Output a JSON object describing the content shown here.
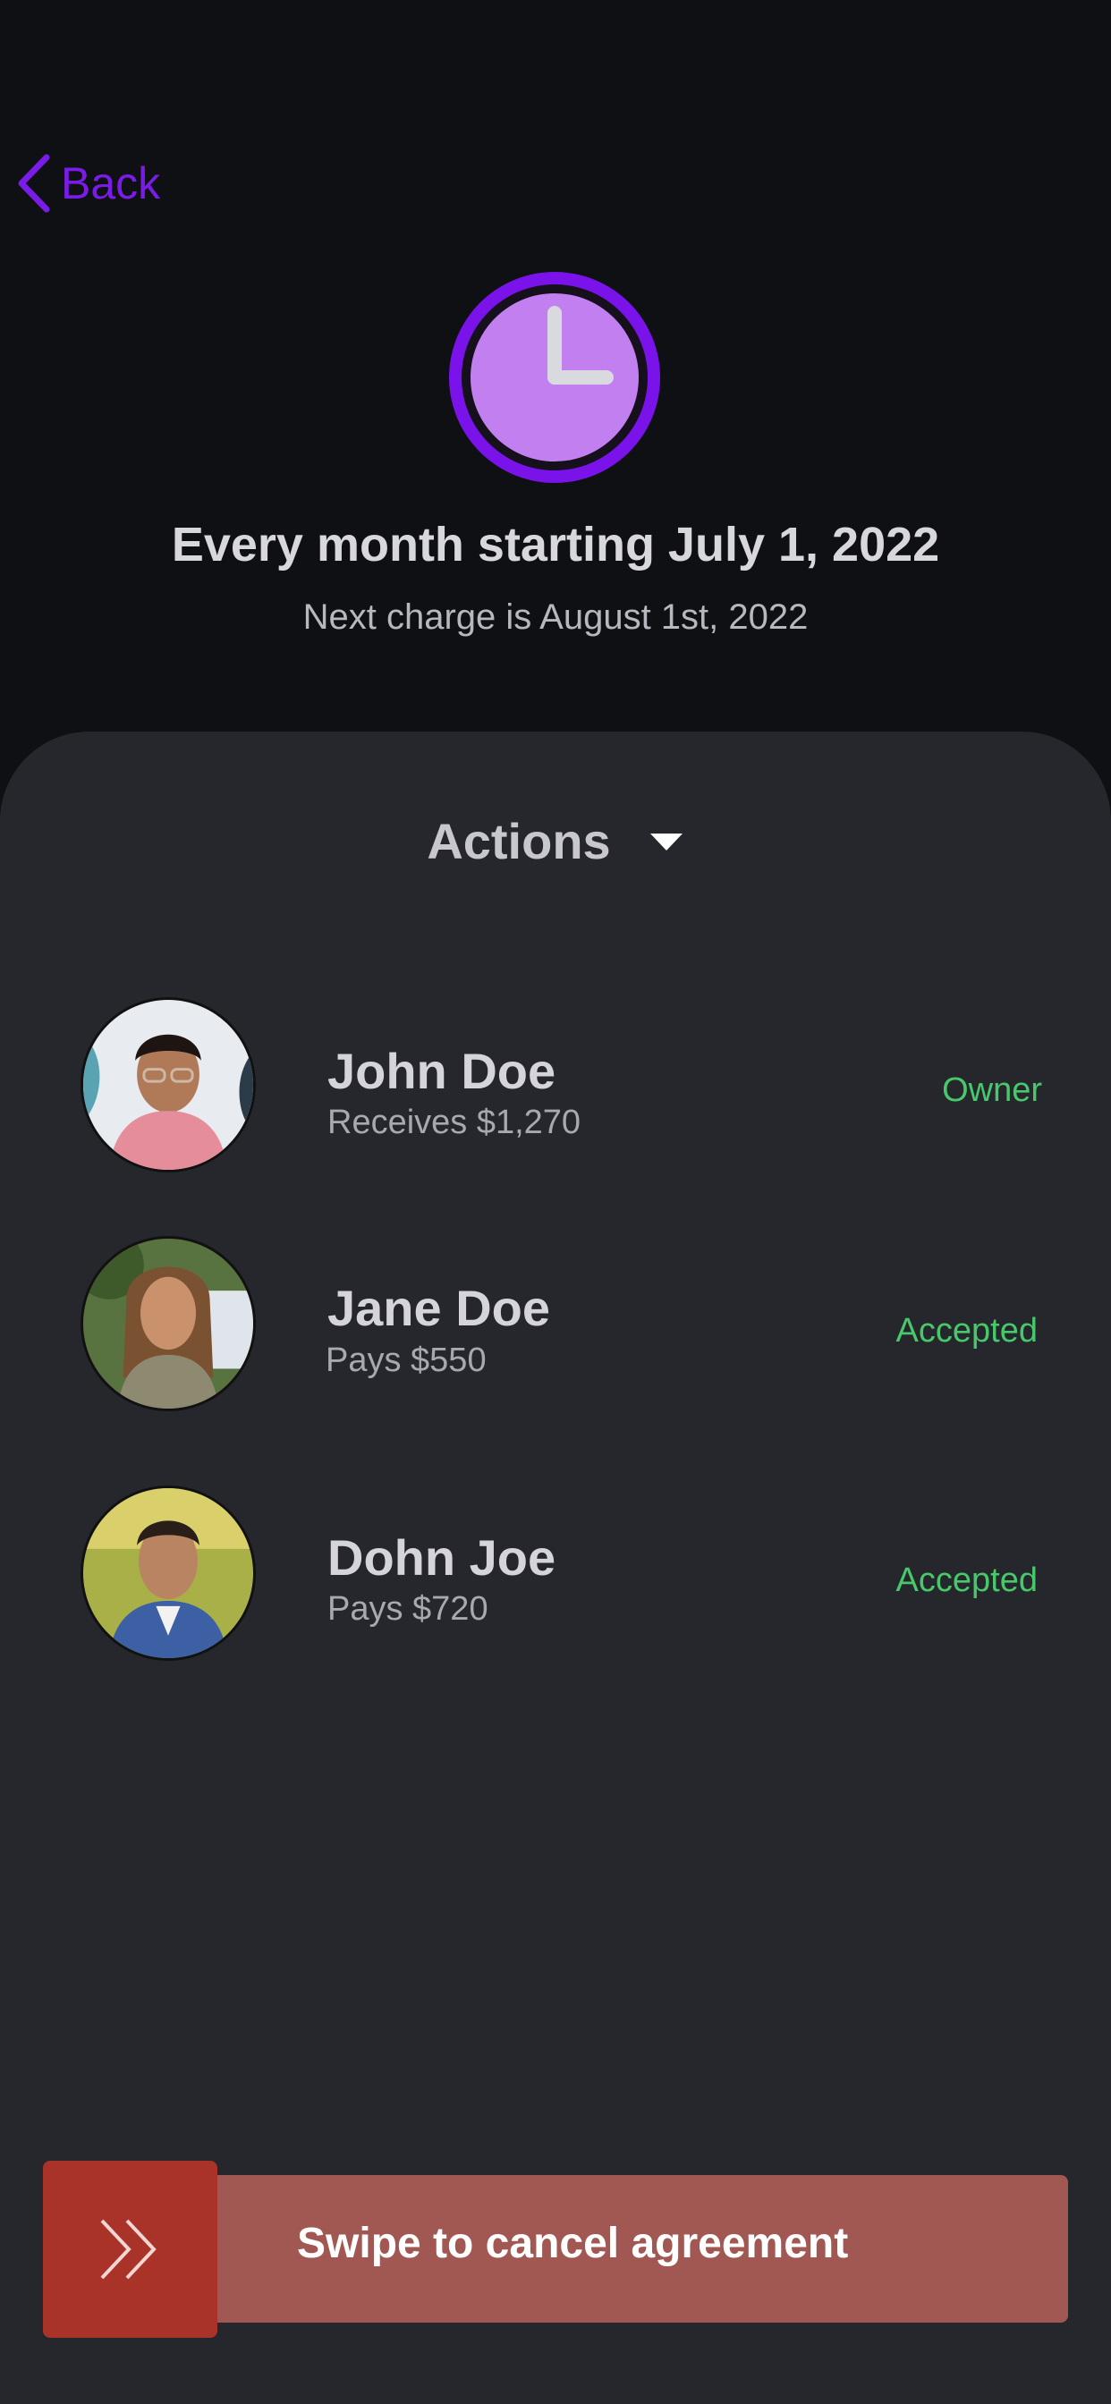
{
  "header": {
    "back_label": "Back",
    "icon": "clock-icon",
    "schedule_title": "Every month starting July 1, 2022",
    "next_charge": "Next charge is August 1st, 2022"
  },
  "actions": {
    "label": "Actions",
    "icon": "caret-down-icon"
  },
  "members": [
    {
      "name": "John Doe",
      "detail": "Receives $1,270",
      "status": "Owner"
    },
    {
      "name": "Jane Doe",
      "detail": "Pays $550",
      "status": "Accepted"
    },
    {
      "name": "Dohn Joe",
      "detail": "Pays $720",
      "status": "Accepted"
    }
  ],
  "swipe": {
    "label": "Swipe to cancel agreement",
    "icon": "double-chevron-right-icon"
  },
  "colors": {
    "background": "#0f1013",
    "panel": "#26272c",
    "accent": "#7a1be8",
    "clock_face": "#c17ff0",
    "status_green": "#47c86b",
    "swipe_track": "#a25852",
    "swipe_handle": "#a93329"
  }
}
